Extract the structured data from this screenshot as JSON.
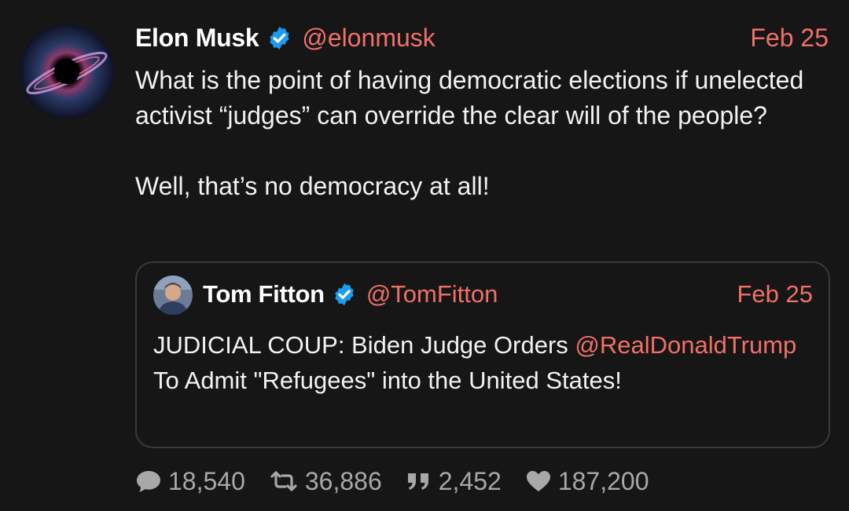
{
  "tweet": {
    "author_name": "Elon Musk",
    "author_handle": "@elonmusk",
    "date": "Feb 25",
    "text": "What is the point of having democratic elections if unelected activist “judges” can override the clear will of the people?\n\nWell, that’s no democracy at all!"
  },
  "quoted_tweet": {
    "author_name": "Tom Fitton",
    "author_handle": "@TomFitton",
    "date": "Feb 25",
    "text_before": "JUDICIAL COUP: Biden Judge Orders ",
    "mention": "@RealDonaldTrump",
    "text_after": " To Admit \"Refugees\" into the United States!"
  },
  "stats": {
    "replies": "18,540",
    "retweets": "36,886",
    "quotes": "2,452",
    "likes": "187,200"
  },
  "colors": {
    "background": "#161616",
    "accent": "#f07068",
    "verified": "#1d9bf0",
    "muted": "#a8a8a8"
  },
  "icons": [
    "reply-icon",
    "retweet-icon",
    "quote-icon",
    "heart-icon",
    "verified-badge-icon"
  ]
}
